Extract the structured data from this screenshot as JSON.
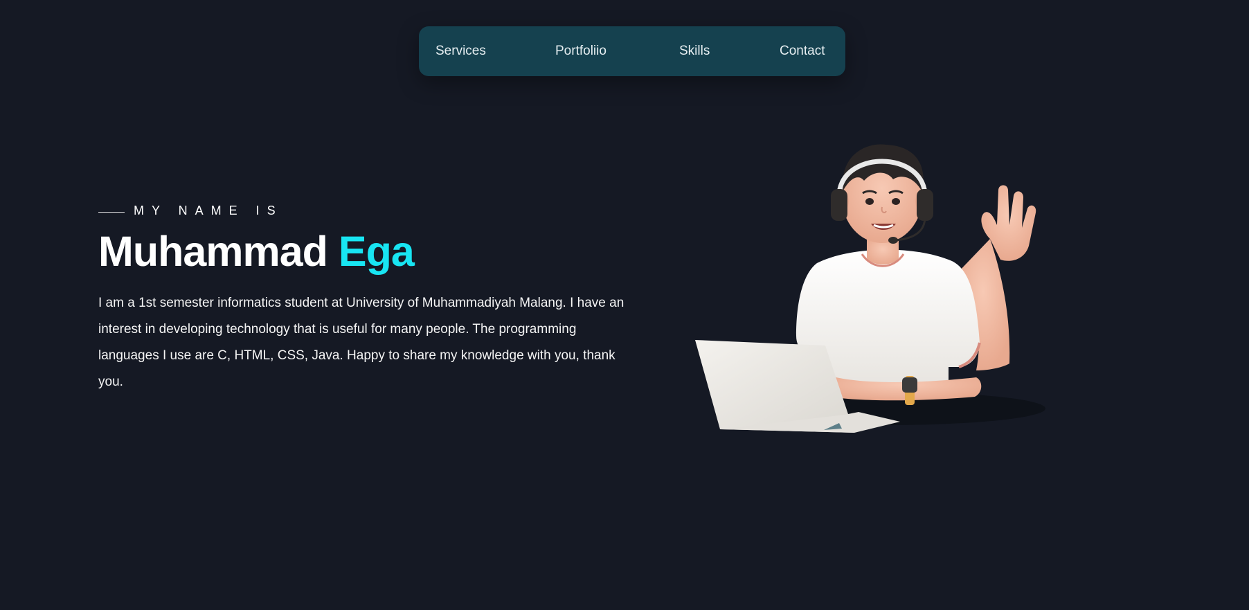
{
  "nav": {
    "items": [
      {
        "label": "Services"
      },
      {
        "label": "Portfoliio"
      },
      {
        "label": "Skills"
      },
      {
        "label": "Contact"
      }
    ]
  },
  "hero": {
    "intro": "MY NAME IS",
    "first_name": "Muhammad",
    "last_name": "Ega",
    "bio": "I am a 1st semester informatics student at University of Muhammadiyah Malang. I have an interest in developing technology that is useful for many people. The programming languages I use are C, HTML, CSS, Java. Happy to share my knowledge with you, thank you."
  },
  "colors": {
    "background": "#151924",
    "nav_background": "#15414f",
    "accent": "#18e5f2",
    "text": "#ffffff"
  },
  "illustration": {
    "icon": "waving-person-with-laptop-illustration"
  }
}
